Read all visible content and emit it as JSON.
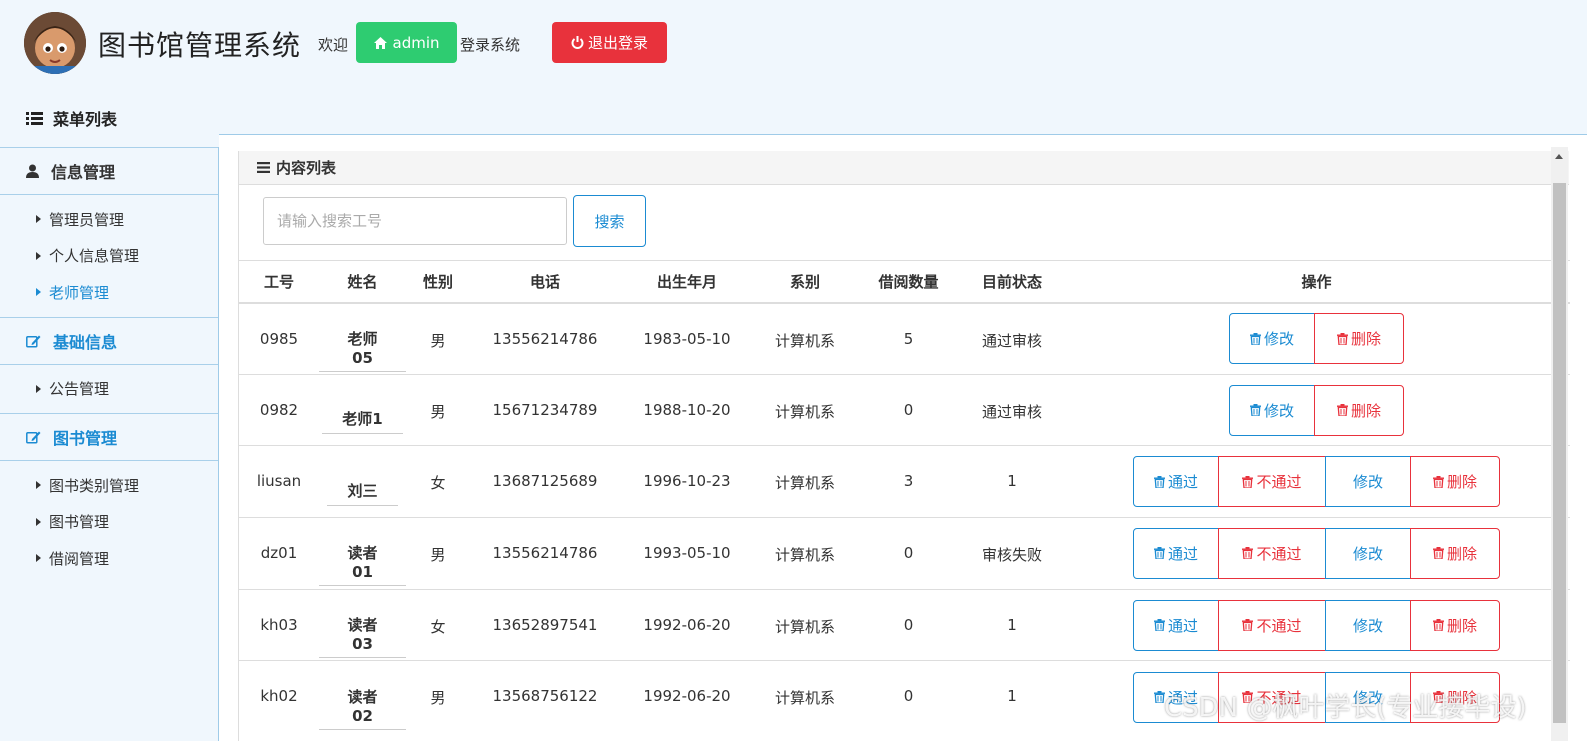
{
  "header": {
    "app_title": "图书馆管理系统",
    "welcome": "欢迎",
    "user": "admin",
    "logged_in": "登录系统",
    "logout": "退出登录",
    "accent_green": "#2ecc71",
    "accent_red": "#e8323c"
  },
  "menu_title": "菜单列表",
  "sidebar": {
    "groups": [
      {
        "label": "信息管理",
        "icon": "user-icon",
        "items": [
          "管理员管理",
          "个人信息管理",
          "老师管理"
        ]
      },
      {
        "label": "基础信息",
        "icon": "edit-icon",
        "items": [
          "公告管理"
        ]
      },
      {
        "label": "图书管理",
        "icon": "edit-icon",
        "items": [
          "图书类别管理",
          "图书管理",
          "借阅管理"
        ]
      }
    ],
    "active_item": "老师管理"
  },
  "panel": {
    "title": "内容列表",
    "search_placeholder": "请输入搜索工号",
    "search_button": "搜索"
  },
  "table": {
    "headers": [
      "工号",
      "姓名",
      "性别",
      "电话",
      "出生年月",
      "系别",
      "借阅数量",
      "目前状态",
      "操作"
    ],
    "rows": [
      {
        "id": "0985",
        "name": "老师05",
        "gender": "男",
        "phone": "13556214786",
        "birth": "1983-05-10",
        "dept": "计算机系",
        "borrow": "5",
        "status": "通过审核"
      },
      {
        "id": "0982",
        "name": "老师1",
        "gender": "男",
        "phone": "15671234789",
        "birth": "1988-10-20",
        "dept": "计算机系",
        "borrow": "0",
        "status": "通过审核"
      },
      {
        "id": "liusan",
        "name": "刘三",
        "gender": "女",
        "phone": "13687125689",
        "birth": "1996-10-23",
        "dept": "计算机系",
        "borrow": "3",
        "status": "1"
      },
      {
        "id": "dz01",
        "name": "读者01",
        "gender": "男",
        "phone": "13556214786",
        "birth": "1993-05-10",
        "dept": "计算机系",
        "borrow": "0",
        "status": "审核失败"
      },
      {
        "id": "kh03",
        "name": "读者03",
        "gender": "女",
        "phone": "13652897541",
        "birth": "1992-06-20",
        "dept": "计算机系",
        "borrow": "0",
        "status": "1"
      },
      {
        "id": "kh02",
        "name": "读者02",
        "gender": "男",
        "phone": "13568756122",
        "birth": "1992-06-20",
        "dept": "计算机系",
        "borrow": "0",
        "status": "1"
      }
    ],
    "op_labels": {
      "approve": "通过",
      "reject": "不通过",
      "edit": "修改",
      "delete": "删除"
    }
  },
  "watermark": "CSDN @枫叶学长(专业接毕设)"
}
